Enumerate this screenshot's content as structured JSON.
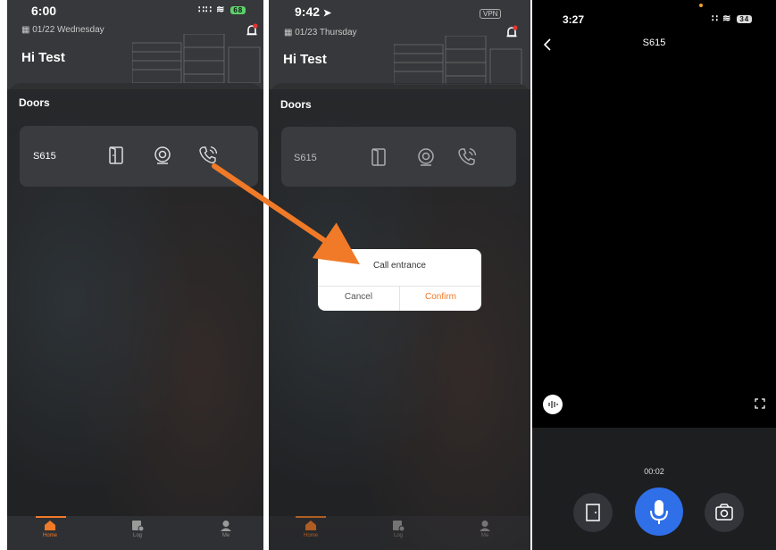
{
  "colors": {
    "accent": "#f07a27",
    "mic": "#2f6fe8",
    "battery": "#5ad26a",
    "bell_dot": "#e0332f"
  },
  "screen1": {
    "time": "6:00",
    "signal": "∷∷",
    "battery": "68",
    "date": "01/22 Wednesday",
    "greeting": "Hi Test",
    "doors_title": "Doors",
    "door": {
      "name": "S615",
      "icons": [
        "door-icon",
        "camera-icon",
        "phone-call-icon"
      ]
    },
    "tabs": [
      {
        "label": "Home",
        "icon": "home-icon",
        "active": true
      },
      {
        "label": "Log",
        "icon": "log-icon",
        "active": false
      },
      {
        "label": "Me",
        "icon": "person-icon",
        "active": false
      }
    ]
  },
  "screen2": {
    "time": "9:42",
    "vpn": "VPN",
    "date": "01/23 Thursday",
    "greeting": "Hi Test",
    "doors_title": "Doors",
    "door": {
      "name": "S615"
    },
    "dialog": {
      "title": "Call entrance",
      "cancel": "Cancel",
      "confirm": "Confirm"
    },
    "tabs": [
      {
        "label": "Home",
        "active": true
      },
      {
        "label": "Log",
        "active": false
      },
      {
        "label": "Me",
        "active": false
      }
    ]
  },
  "screen3": {
    "time": "3:27",
    "battery": "34",
    "title": "S615",
    "timer": "00:02",
    "controls": [
      "door-icon",
      "microphone-icon",
      "camera-snapshot-icon"
    ]
  }
}
